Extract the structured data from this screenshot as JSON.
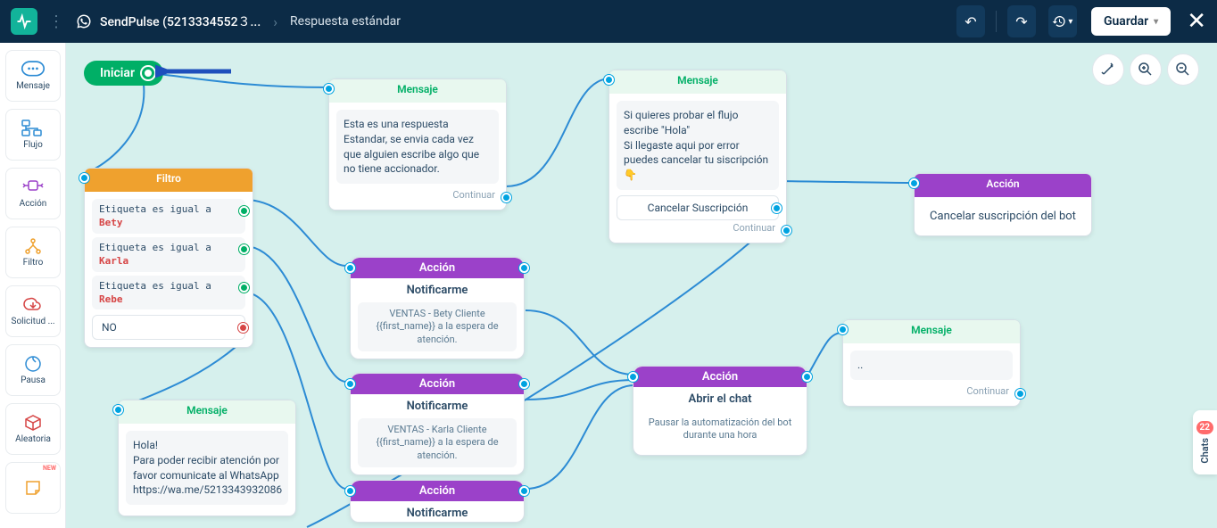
{
  "header": {
    "account_name": "SendPulse (5213334552３...",
    "page_title": "Respuesta estándar",
    "save_label": "Guardar"
  },
  "sidebar": {
    "items": [
      {
        "label": "Mensaje"
      },
      {
        "label": "Flujo"
      },
      {
        "label": "Acción"
      },
      {
        "label": "Filtro"
      },
      {
        "label": "Solicitud ..."
      },
      {
        "label": "Pausa"
      },
      {
        "label": "Aleatoria"
      }
    ]
  },
  "start": {
    "label": "Iniciar"
  },
  "filter": {
    "title": "Filtro",
    "rows": [
      {
        "field": "Etiqueta",
        "op": "es igual a",
        "val": "Bety"
      },
      {
        "field": "Etiqueta",
        "op": "es igual a",
        "val": "Karla"
      },
      {
        "field": "Etiqueta",
        "op": "es igual a",
        "val": "Rebe"
      }
    ],
    "no_label": "NO"
  },
  "msg1": {
    "title": "Mensaje",
    "body": "Esta es una respuesta Estandar, se envia cada vez que alguien escribe algo que no tiene accionador.",
    "continue": "Continuar"
  },
  "msg2": {
    "title": "Mensaje",
    "line1": "Si quieres probar el flujo escribe \"Hola\"",
    "line2": "Si llegaste aqui por error puedes cancelar tu siscripción 👇",
    "button": "Cancelar Suscripción",
    "continue": "Continuar"
  },
  "action_cancel": {
    "title": "Acción",
    "body": "Cancelar suscripción del bot"
  },
  "action_bety": {
    "title": "Acción",
    "sub": "Notificarme",
    "body": "VENTAS - Bety Cliente {{first_name}} a la espera de atención."
  },
  "action_karla": {
    "title": "Acción",
    "sub": "Notificarme",
    "body": "VENTAS - Karla Cliente {{first_name}} a la espera de atención."
  },
  "action_rebe": {
    "title": "Acción",
    "sub": "Notificarme"
  },
  "action_open": {
    "title": "Acción",
    "sub": "Abrir el chat",
    "body": "Pausar la automatización del bot durante  una hora"
  },
  "msg3": {
    "title": "Mensaje",
    "body": "..",
    "continue": "Continuar"
  },
  "msg4": {
    "title": "Mensaje",
    "body": "Hola!\nPara poder recibir atención por favor comunicate al WhatsApp https://wa.me/5213343932086"
  },
  "chats": {
    "label": "Chats",
    "count": "22"
  }
}
